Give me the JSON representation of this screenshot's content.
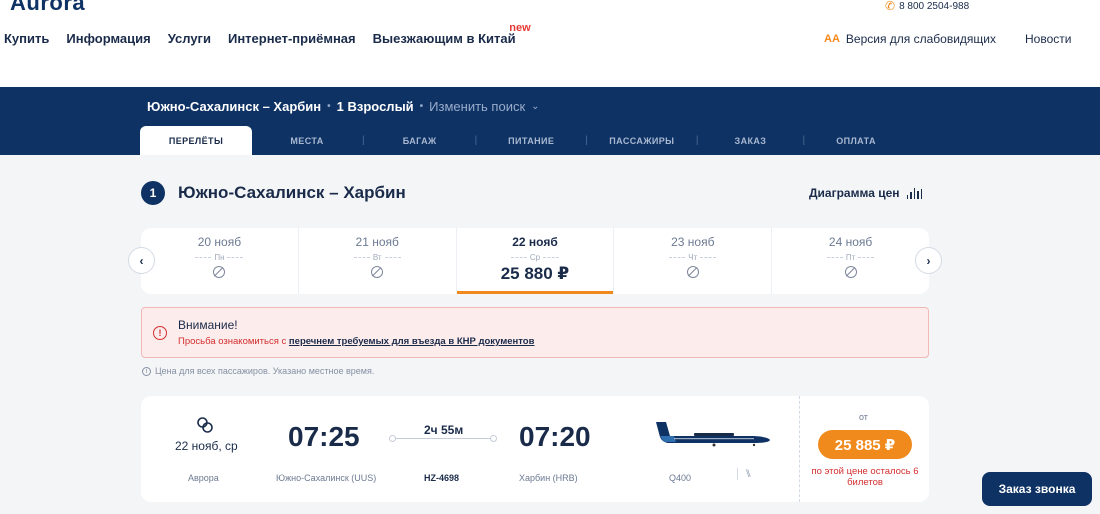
{
  "header": {
    "logo": "Aurora",
    "phone": "8 800 2504-988",
    "nav": [
      "Купить",
      "Информация",
      "Услуги",
      "Интернет-приёмная",
      "Выезжающим в Китай"
    ],
    "new_badge": "new",
    "accessibility_icon": "AA",
    "accessibility": "Версия для слабовидящих",
    "news": "Новости"
  },
  "search": {
    "route": "Южно-Сахалинск – Харбин",
    "passengers": "1 Взрослый",
    "change": "Изменить поиск"
  },
  "steps": [
    "ПЕРЕЛЁТЫ",
    "МЕСТА",
    "БАГАЖ",
    "ПИТАНИЕ",
    "ПАССАЖИРЫ",
    "ЗАКАЗ",
    "ОПЛАТА"
  ],
  "section": {
    "number": "1",
    "title": "Южно-Сахалинск – Харбин",
    "price_chart": "Диаграмма цен"
  },
  "dates": [
    {
      "date": "20 нояб",
      "weekday": "Пн",
      "price": null
    },
    {
      "date": "21 нояб",
      "weekday": "Вт",
      "price": null
    },
    {
      "date": "22 нояб",
      "weekday": "Ср",
      "price": "25 880 ₽"
    },
    {
      "date": "23 нояб",
      "weekday": "Чт",
      "price": null
    },
    {
      "date": "24 нояб",
      "weekday": "Пт",
      "price": null
    }
  ],
  "warning": {
    "title": "Внимание!",
    "text_before": "Просьба ознакомиться с ",
    "link": "перечнем требуемых для въезда в КНР документов"
  },
  "info_note": "Цена для всех пассажиров. Указано местное время.",
  "flight": {
    "date": "22 нояб, ср",
    "carrier": "Аврора",
    "departure_time": "07:25",
    "departure_airport": "Южно-Сахалинск (UUS)",
    "duration": "2ч 55м",
    "flight_number": "HZ-4698",
    "arrival_time": "07:20",
    "arrival_airport": "Харбин (HRB)",
    "aircraft": "Q400",
    "from_label": "от",
    "price": "25 885 ₽",
    "tickets_left": "по этой цене осталось 6 билетов"
  },
  "callback": "Заказ звонка",
  "colors": {
    "brand": "#0e3264",
    "accent": "#f08a1c",
    "alert": "#d32f2f"
  }
}
